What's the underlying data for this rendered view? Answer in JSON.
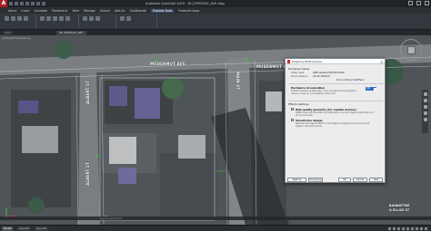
{
  "app": {
    "logo_letter": "A",
    "window_title": "Autodesk AutoCAD 2019 · DH_PORTAGE_AVE.dwg"
  },
  "menu": {
    "items": [
      "Home",
      "Insert",
      "Annotate",
      "Parametric",
      "View",
      "Manage",
      "Output",
      "Add-ins",
      "Collaborate",
      "Express Tools",
      "Featured Apps"
    ],
    "active_index": 9
  },
  "file_tabs": [
    {
      "label": "Start",
      "active": false
    },
    {
      "label": "DH_PORTAGE_AVE*",
      "active": true
    }
  ],
  "viewport": {
    "label": "[-][Top][2D Wireframe]"
  },
  "streets": {
    "mudermot_1": "MUDERMOT AVE",
    "mudermot_2": "MUDERMOT AVE",
    "albert_1": "ALBERT ST",
    "albert_2": "ALBERT ST",
    "main": "MAIN ST",
    "intersection_line1": "BANNATYNE",
    "intersection_line2": "& ELLICE ST"
  },
  "dialog": {
    "title": "Graphics Performance",
    "hardware_setup_heading": "Hardware Setup",
    "video_card_label": "Video Card:",
    "video_card_value": "AMD Radeon(TM) R5 M330",
    "driver_version_label": "Driver Version:",
    "driver_version_value": "25.20.15002.0",
    "driver_status_label": "Driver Status:",
    "driver_status_value": "Certified ✓",
    "hw_accel_label": "Hardware Acceleration",
    "hw_accel_desc": "Enable hardware acceleration if you are experiencing graphics issues or have an incompatible video card.",
    "hw_accel_state": "ON",
    "effects_heading": "Effects Settings",
    "opt1_label": "High quality geometry (for capable devices)",
    "opt1_desc": "Makes lines look smoother and improves curve and display performance in 2D environment.",
    "opt2_label": "Smooth line display",
    "opt2_desc": "Removes the jagged effect on the display of diagonal lines and curved edges in 2D environment.",
    "buttons": [
      "Restore Defaults",
      "Tuning Log",
      "OK",
      "Cancel",
      "Help"
    ]
  },
  "command_line": {
    "prompt": "Type a command"
  },
  "status_bar": {
    "layout_tabs": [
      "Model",
      "Layout1",
      "Layout2"
    ],
    "active_tab": 0
  }
}
